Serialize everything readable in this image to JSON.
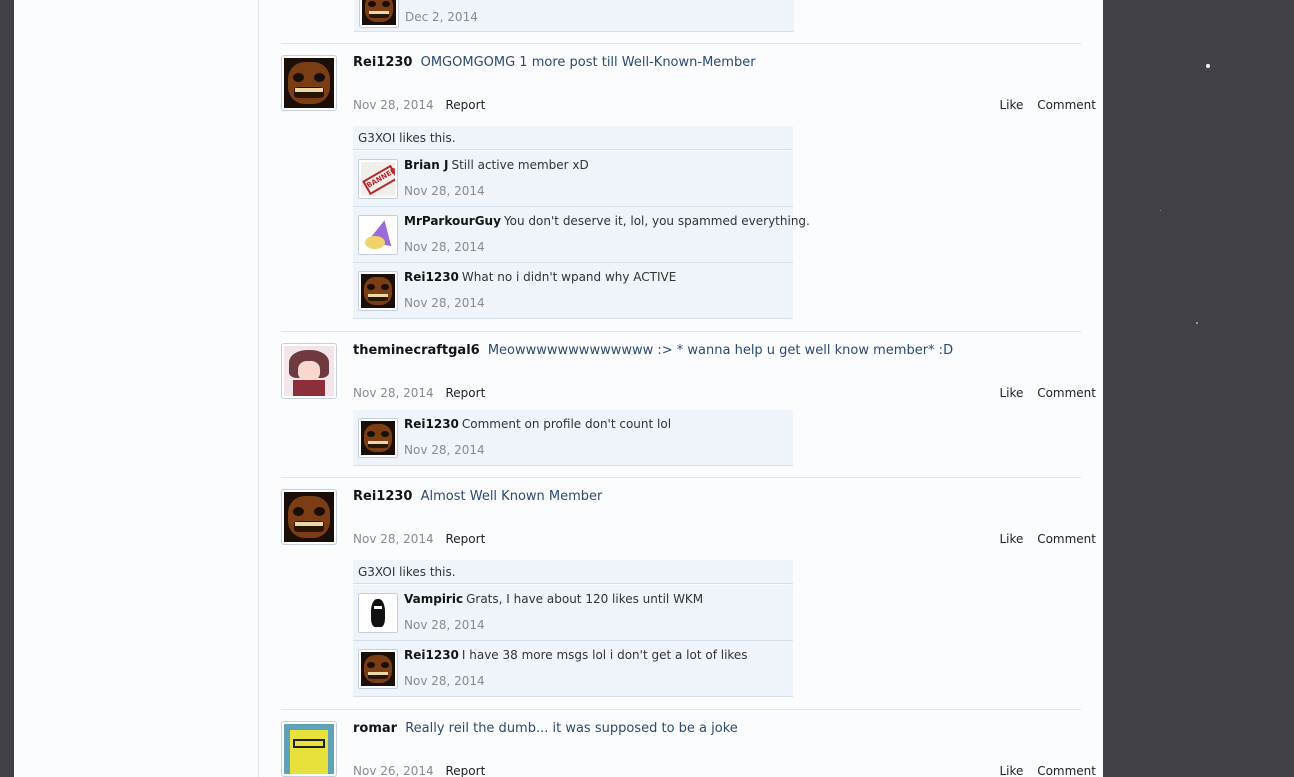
{
  "top_comment": {
    "date": "Dec 2, 2014"
  },
  "posts": [
    {
      "user": "Rei1230",
      "message": "OMGOMGOMG 1 more post till Well-Known-Member",
      "date": "Nov 28, 2014",
      "report": "Report",
      "like": "Like",
      "comment": "Comment",
      "likes_text": "G3XOI likes this.",
      "comments": [
        {
          "user": "Brian J",
          "text": "Still active member xD",
          "date": "Nov 28, 2014"
        },
        {
          "user": "MrParkourGuy",
          "text": "You don't deserve it, lol, you spammed everything.",
          "date": "Nov 28, 2014"
        },
        {
          "user": "Rei1230",
          "text": "What no i didn't wpand why ACTIVE",
          "date": "Nov 28, 2014"
        }
      ]
    },
    {
      "user": "theminecraftgal6",
      "message": "Meowwwwwwwwwwwww :> * wanna help u get well know member* :D",
      "date": "Nov 28, 2014",
      "report": "Report",
      "like": "Like",
      "comment": "Comment",
      "comments": [
        {
          "user": "Rei1230",
          "text": "Comment on profile don't count lol",
          "date": "Nov 28, 2014"
        }
      ]
    },
    {
      "user": "Rei1230",
      "message": "Almost Well Known Member",
      "date": "Nov 28, 2014",
      "report": "Report",
      "like": "Like",
      "comment": "Comment",
      "likes_text": "G3XOI likes this.",
      "comments": [
        {
          "user": "Vampiric",
          "text": "Grats, I have about 120 likes until WKM",
          "date": "Nov 28, 2014"
        },
        {
          "user": "Rei1230",
          "text": "I have 38 more msgs lol i don't get a lot of likes",
          "date": "Nov 28, 2014"
        }
      ]
    },
    {
      "user": "romar",
      "message": "Really reil the dumb... it was supposed to be a joke",
      "date": "Nov 26, 2014",
      "report": "Report",
      "like": "Like",
      "comment": "Comment"
    }
  ]
}
